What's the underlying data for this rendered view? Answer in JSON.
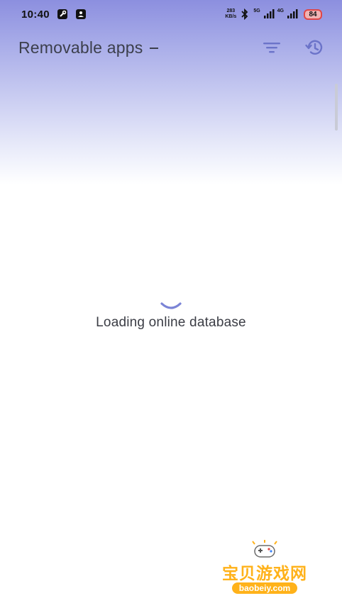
{
  "status_bar": {
    "time": "10:40",
    "net_speed_value": "283",
    "net_speed_unit": "KB/s",
    "network_1": "5G",
    "network_2": "4G",
    "battery": "84"
  },
  "app_bar": {
    "title": "Removable apps"
  },
  "loading": {
    "text": "Loading online database"
  },
  "watermark": {
    "name": "宝贝游戏网",
    "url": "baobeiy.com"
  },
  "colors": {
    "accent": "#7b84d6",
    "header_gradient_top": "#8c8fdf",
    "battery_border": "#e04646",
    "watermark": "#ffb21a"
  }
}
